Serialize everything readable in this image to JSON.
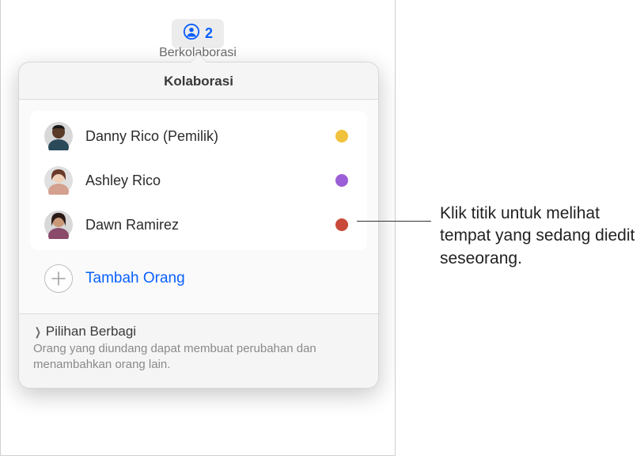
{
  "toolbar": {
    "count": "2",
    "label": "Berkolaborasi",
    "icon_color": "#0a60ff"
  },
  "popover": {
    "title": "Kolaborasi",
    "people": [
      {
        "name": "Danny Rico (Pemilik)",
        "dot_color": "#f0c23c",
        "avatar_bg": "#8b5a3c",
        "skin": "#5a3a28"
      },
      {
        "name": "Ashley Rico",
        "dot_color": "#9a5fd6",
        "avatar_bg": "#e8c8b8",
        "skin": "#f0d0b8"
      },
      {
        "name": "Dawn Ramirez",
        "dot_color": "#c94a3a",
        "avatar_bg": "#b88868",
        "skin": "#c89878"
      }
    ],
    "add_label": "Tambah Orang",
    "footer_title": "Pilihan Berbagi",
    "footer_sub": "Orang yang diundang dapat membuat perubahan dan menambahkan orang lain."
  },
  "callout": {
    "text": "Klik titik untuk melihat tempat yang sedang diedit seseorang."
  }
}
